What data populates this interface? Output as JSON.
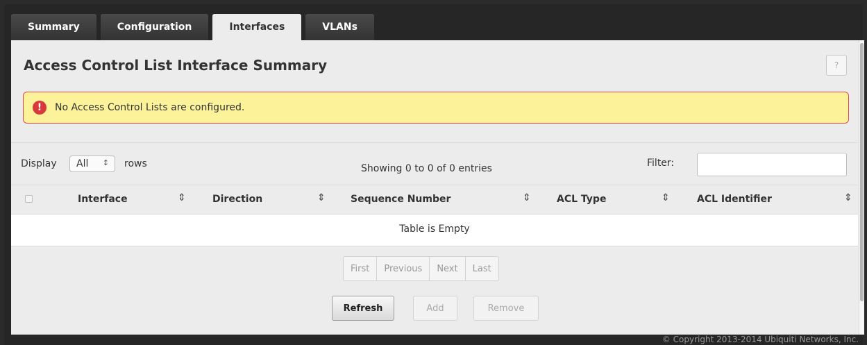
{
  "tabs": [
    {
      "label": "Summary",
      "active": false
    },
    {
      "label": "Configuration",
      "active": false
    },
    {
      "label": "Interfaces",
      "active": true
    },
    {
      "label": "VLANs",
      "active": false
    }
  ],
  "page": {
    "title": "Access Control List Interface Summary",
    "help_label": "?"
  },
  "alert": {
    "icon": "exclamation-circle-icon",
    "icon_glyph": "!",
    "message": "No Access Control Lists are configured.",
    "background": "#fbf29a",
    "border": "#e14a4a"
  },
  "controls": {
    "display_label": "Display",
    "rows_value": "All",
    "rows_label": "rows",
    "showing_text": "Showing 0 to 0 of 0 entries",
    "filter_label": "Filter:",
    "filter_value": ""
  },
  "table": {
    "columns": [
      "Interface",
      "Direction",
      "Sequence Number",
      "ACL Type",
      "ACL Identifier"
    ],
    "empty_text": "Table is Empty"
  },
  "pagination": [
    "First",
    "Previous",
    "Next",
    "Last"
  ],
  "buttons": {
    "refresh": "Refresh",
    "add": "Add",
    "remove": "Remove"
  },
  "footer": {
    "copyright": "© Copyright 2013-2014 Ubiquiti Networks, Inc."
  }
}
